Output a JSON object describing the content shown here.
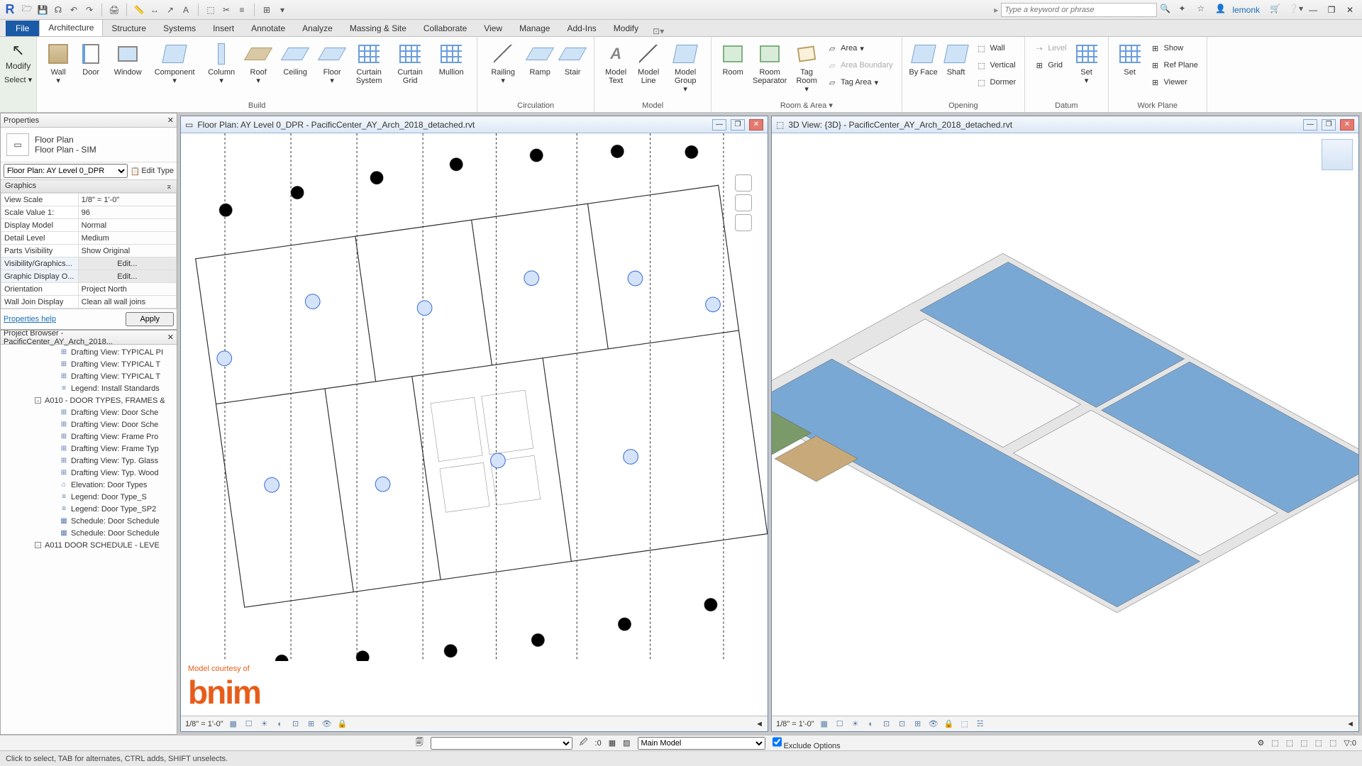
{
  "titlebar": {
    "search_placeholder": "Type a keyword or phrase",
    "user": "lemonk"
  },
  "tabs": {
    "file": "File",
    "items": [
      "Architecture",
      "Structure",
      "Systems",
      "Insert",
      "Annotate",
      "Analyze",
      "Massing & Site",
      "Collaborate",
      "View",
      "Manage",
      "Add-Ins",
      "Modify"
    ],
    "active": 0
  },
  "ribbon": {
    "modify": {
      "label": "Modify",
      "select": "Select"
    },
    "build": {
      "label": "Build",
      "items": [
        "Wall",
        "Door",
        "Window",
        "Component",
        "Column",
        "Roof",
        "Ceiling",
        "Floor",
        "Curtain System",
        "Curtain Grid",
        "Mullion"
      ]
    },
    "circulation": {
      "label": "Circulation",
      "items": [
        "Railing",
        "Ramp",
        "Stair"
      ]
    },
    "model": {
      "label": "Model",
      "items": [
        "Model Text",
        "Model Line",
        "Model Group"
      ]
    },
    "room": {
      "label": "Room & Area",
      "items": [
        "Room",
        "Room Separator",
        "Tag Room"
      ],
      "side": [
        "Area",
        "Area Boundary",
        "Tag Area"
      ]
    },
    "opening": {
      "label": "Opening",
      "items": [
        "By Face",
        "Shaft"
      ],
      "side": [
        "Wall",
        "Vertical",
        "Dormer"
      ]
    },
    "datum": {
      "label": "Datum",
      "side": [
        "Level",
        "Grid"
      ],
      "items": [
        "Set"
      ]
    },
    "work": {
      "label": "Work Plane",
      "side": [
        "Show",
        "Ref Plane",
        "Viewer"
      ],
      "items": [
        "Set"
      ]
    }
  },
  "properties": {
    "title": "Properties",
    "type_name": "Floor Plan",
    "type_sub": "Floor Plan - SIM",
    "view_sel": "Floor Plan: AY Level 0_DPR",
    "edit_type": "Edit Type",
    "cat": "Graphics",
    "rows": [
      {
        "k": "View Scale",
        "v": "1/8\" = 1'-0\""
      },
      {
        "k": "Scale Value    1:",
        "v": "96"
      },
      {
        "k": "Display Model",
        "v": "Normal"
      },
      {
        "k": "Detail Level",
        "v": "Medium"
      },
      {
        "k": "Parts Visibility",
        "v": "Show Original"
      },
      {
        "k": "Visibility/Graphics...",
        "v": "Edit...",
        "btn": true,
        "hl": true
      },
      {
        "k": "Graphic Display O...",
        "v": "Edit...",
        "btn": true,
        "hl": true
      },
      {
        "k": "Orientation",
        "v": "Project North"
      },
      {
        "k": "Wall Join Display",
        "v": "Clean all wall joins"
      }
    ],
    "help": "Properties help",
    "apply": "Apply"
  },
  "browser": {
    "title": "Project Browser - PacificCenter_AY_Arch_2018...",
    "items": [
      {
        "ind": 80,
        "icon": "⊞",
        "label": "Drafting View: TYPICAL PI"
      },
      {
        "ind": 80,
        "icon": "⊞",
        "label": "Drafting View: TYPICAL T"
      },
      {
        "ind": 80,
        "icon": "⊞",
        "label": "Drafting View: TYPICAL T"
      },
      {
        "ind": 80,
        "icon": "≡",
        "label": "Legend: Install Standards"
      },
      {
        "ind": 46,
        "exp": "-",
        "label": "A010 - DOOR TYPES, FRAMES &"
      },
      {
        "ind": 80,
        "icon": "⊞",
        "label": "Drafting View: Door Sche"
      },
      {
        "ind": 80,
        "icon": "⊞",
        "label": "Drafting View: Door Sche"
      },
      {
        "ind": 80,
        "icon": "⊞",
        "label": "Drafting View: Frame Pro"
      },
      {
        "ind": 80,
        "icon": "⊞",
        "label": "Drafting View: Frame Typ"
      },
      {
        "ind": 80,
        "icon": "⊞",
        "label": "Drafting View: Typ. Glass"
      },
      {
        "ind": 80,
        "icon": "⊞",
        "label": "Drafting View: Typ. Wood"
      },
      {
        "ind": 80,
        "icon": "⌂",
        "label": "Elevation: Door Types"
      },
      {
        "ind": 80,
        "icon": "≡",
        "label": "Legend: Door Type_S"
      },
      {
        "ind": 80,
        "icon": "≡",
        "label": "Legend: Door Type_SP2"
      },
      {
        "ind": 80,
        "icon": "▦",
        "label": "Schedule: Door Schedule"
      },
      {
        "ind": 80,
        "icon": "▦",
        "label": "Schedule: Door Schedule"
      },
      {
        "ind": 46,
        "exp": "",
        "label": "A011   DOOR SCHEDULE - LEVE"
      }
    ]
  },
  "view1": {
    "title": "Floor Plan: AY Level 0_DPR - PacificCenter_AY_Arch_2018_detached.rvt",
    "scale": "1/8\" = 1'-0\"",
    "credit_small": "Model courtesy of",
    "credit": "bnim"
  },
  "view2": {
    "title": "3D View: {3D} - PacificCenter_AY_Arch_2018_detached.rvt",
    "scale": "1/8\" = 1'-0\""
  },
  "optbar": {
    "worksets": ":0",
    "main_model": "Main Model",
    "exclude": "Exclude Options"
  },
  "status": {
    "msg": "Click to select, TAB for alternates, CTRL adds, SHIFT unselects."
  }
}
